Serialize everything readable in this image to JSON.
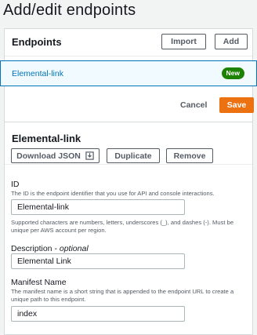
{
  "page": {
    "title": "Add/edit endpoints"
  },
  "endpoints": {
    "title": "Endpoints",
    "import_label": "Import",
    "add_label": "Add",
    "items": [
      {
        "name": "Elemental-link",
        "badge": "New"
      }
    ]
  },
  "actions": {
    "cancel_label": "Cancel",
    "save_label": "Save"
  },
  "detail": {
    "title": "Elemental-link",
    "download_label": "Download JSON",
    "duplicate_label": "Duplicate",
    "remove_label": "Remove",
    "id": {
      "label": "ID",
      "description": "The ID is the endpoint identifier that you use for API and console interactions.",
      "value": "Elemental-link",
      "constraint": "Supported characters are numbers, letters, underscores (_), and dashes (-). Must be unique per AWS account per region."
    },
    "description": {
      "label": "Description",
      "optional": "optional",
      "separator": " - ",
      "value": "Elemental Link"
    },
    "manifest": {
      "label": "Manifest Name",
      "description": "The manifest name is a short string that is appended to the endpoint URL to create a unique path to this endpoint.",
      "value": "index"
    }
  },
  "colors": {
    "accent": "#0073bb",
    "save": "#ec7211",
    "badge": "#1d8102",
    "selected_bg": "#f1faff"
  }
}
